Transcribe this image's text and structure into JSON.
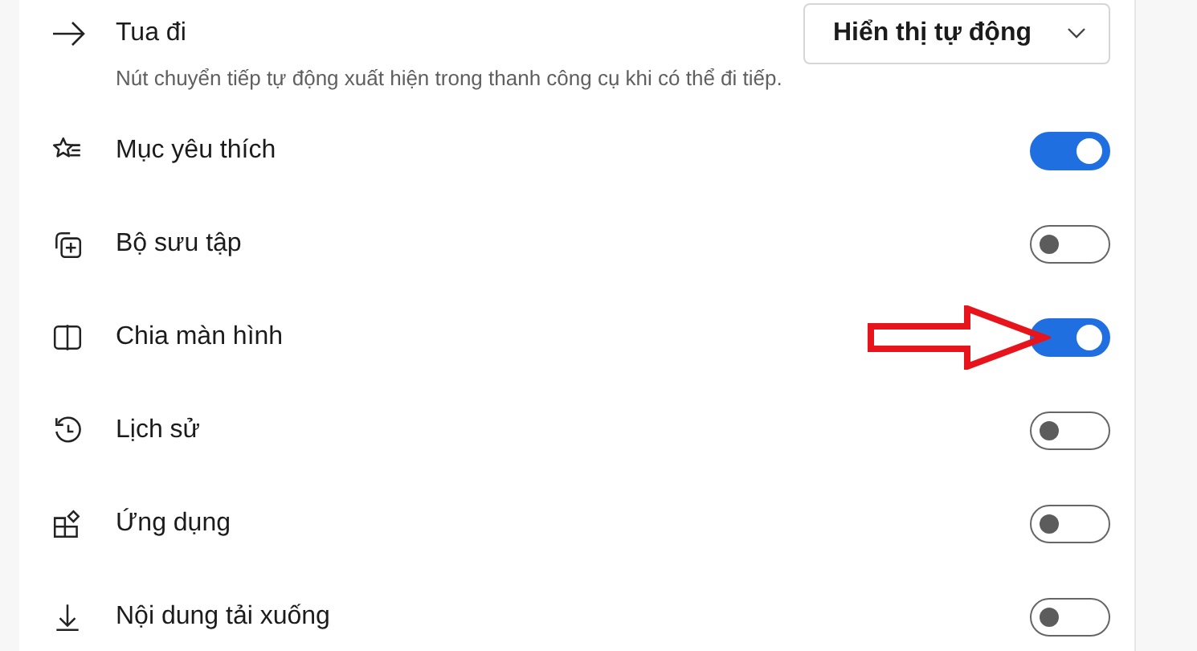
{
  "forward_setting": {
    "label": "Tua đi",
    "description": "Nút chuyển tiếp tự động xuất hiện trong thanh công cụ khi có thể đi tiếp.",
    "dropdown": "Hiển thị tự động"
  },
  "toggles": [
    {
      "kind": "favorites",
      "label": "Mục yêu thích",
      "on": true
    },
    {
      "kind": "collections",
      "label": "Bộ sưu tập",
      "on": false
    },
    {
      "kind": "split",
      "label": "Chia màn hình",
      "on": true
    },
    {
      "kind": "history",
      "label": "Lịch sử",
      "on": false
    },
    {
      "kind": "apps",
      "label": "Ứng dụng",
      "on": false
    },
    {
      "kind": "downloads",
      "label": "Nội dung tải xuống",
      "on": false
    }
  ]
}
